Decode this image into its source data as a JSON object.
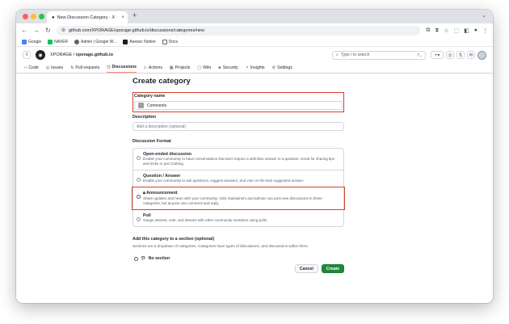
{
  "browser": {
    "tab_title": "New Discussion Category · X",
    "tab_close": "×",
    "new_tab": "+",
    "url": "github.com/XPORAGE/xporage.github.io/discussions/categories/new",
    "bookmarks": [
      {
        "label": "Google",
        "color": "#4285f4"
      },
      {
        "label": "NAVER",
        "color": "#03c75a"
      },
      {
        "label": "Admin | Google W...",
        "color": "#5f6368"
      },
      {
        "label": "Asesec Notion",
        "color": "#1f1f1f"
      },
      {
        "label": "Docs",
        "color": "#5f6368"
      }
    ]
  },
  "github": {
    "owner": "XPORAGE",
    "separator": "/",
    "repo": "xporage.github.io",
    "search_placeholder": "Type / to search",
    "search_shortcut": ">_",
    "nav": [
      {
        "label": "Code",
        "icon": "‹›",
        "active": false
      },
      {
        "label": "Issues",
        "icon": "◎",
        "active": false
      },
      {
        "label": "Pull requests",
        "icon": "⇅",
        "active": false
      },
      {
        "label": "Discussions",
        "icon": "◻",
        "active": true
      },
      {
        "label": "Actions",
        "icon": "▷",
        "active": false
      },
      {
        "label": "Projects",
        "icon": "▦",
        "active": false
      },
      {
        "label": "Wiki",
        "icon": "▢",
        "active": false
      },
      {
        "label": "Security",
        "icon": "◈",
        "active": false
      },
      {
        "label": "Insights",
        "icon": "↗",
        "active": false
      },
      {
        "label": "Settings",
        "icon": "⚙",
        "active": false
      }
    ]
  },
  "form": {
    "page_title": "Create category",
    "name_label": "Category name",
    "name_value": "Comments",
    "description_label": "Description",
    "description_placeholder": "Add a description (optional)",
    "format_label": "Discussion Format",
    "formats": [
      {
        "title": "Open-ended discussion",
        "desc": "Enable your community to have conversations that don't require a definitive answer to a question. Great for sharing tips and tricks or just chatting.",
        "selected": false,
        "highlight": false
      },
      {
        "title": "Question / Answer",
        "desc": "Enable your community to ask questions, suggest answers, and vote on the best suggested answer.",
        "selected": false,
        "highlight": false
      },
      {
        "title": "Announcement",
        "desc": "Share updates and news with your community. Only maintainers and admins can post new discussions in these categories, but anyone can comment and reply.",
        "selected": true,
        "highlight": true
      },
      {
        "title": "Poll",
        "desc": "Gauge interest, vote, and interact with other community members using polls.",
        "selected": false,
        "highlight": false
      }
    ],
    "section_label": "Add this category to a section (optional)",
    "section_note": "Sections are a dropdown of categories. Categories have types of discussions, and discussions within them.",
    "no_section": "No section",
    "cancel_label": "Cancel",
    "create_label": "Create"
  },
  "colors": {
    "highlight": "#d9402a",
    "create_button": "#1f883d",
    "active_tab_underline": "#fd8c73"
  }
}
